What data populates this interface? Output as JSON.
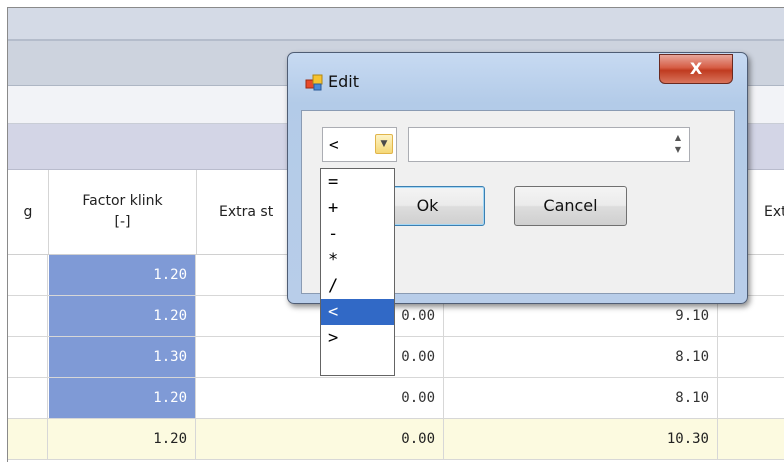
{
  "grid": {
    "headers": [
      {
        "label": "g"
      },
      {
        "label": "Factor klink\n[-]"
      },
      {
        "label": "Extra st"
      },
      {
        "label": ""
      },
      {
        "label": "Extra"
      }
    ],
    "rows": [
      {
        "cells": [
          "",
          "1.20",
          "",
          "",
          ""
        ],
        "selected": true,
        "highlight": false
      },
      {
        "cells": [
          "",
          "1.20",
          "0.00",
          "9.10",
          ""
        ],
        "selected": true,
        "highlight": false
      },
      {
        "cells": [
          "",
          "1.30",
          "0.00",
          "8.10",
          ""
        ],
        "selected": true,
        "highlight": false
      },
      {
        "cells": [
          "",
          "1.20",
          "0.00",
          "8.10",
          ""
        ],
        "selected": true,
        "highlight": false
      },
      {
        "cells": [
          "",
          "1.20",
          "0.00",
          "10.30",
          ""
        ],
        "selected": false,
        "highlight": true
      }
    ]
  },
  "dialog": {
    "title": "Edit",
    "close_label": "X",
    "operator_value": "<",
    "number_value": "",
    "ok_label": "Ok",
    "cancel_label": "Cancel",
    "operator_options": [
      "=",
      "+",
      "-",
      "*",
      "/",
      "<",
      ">"
    ],
    "selected_option": "<"
  },
  "colors": {
    "selected_cell": "#7f9ad6",
    "highlight_row": "#fcfae0",
    "dropdown_highlight": "#3169c6",
    "close_button": "#c03b20"
  }
}
